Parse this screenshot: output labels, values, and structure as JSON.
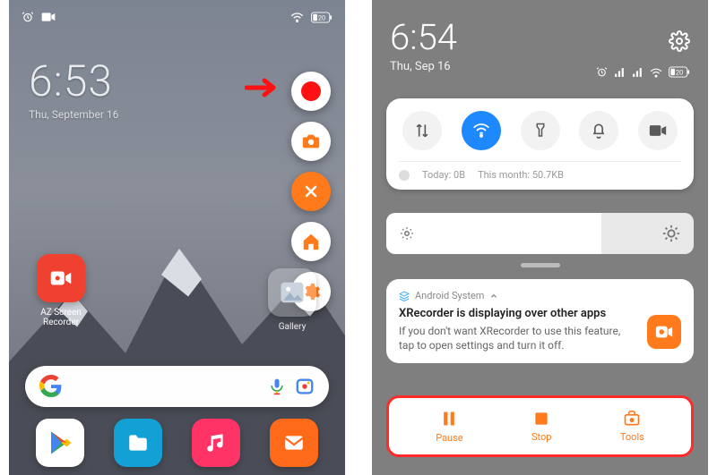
{
  "left": {
    "status": {
      "battery": "20",
      "alarm": true,
      "camera": true
    },
    "clock": {
      "time": "6:53",
      "date": "Thu, September 16"
    },
    "fab": {
      "record": "record",
      "screenshot": "screenshot",
      "close": "close",
      "home": "home",
      "settings": "settings"
    },
    "apps": {
      "az": {
        "name": "AZ Screen Recorder"
      },
      "gallery": {
        "name": "Gallery"
      }
    },
    "dock": {
      "play": "Play Store",
      "files": "Files",
      "music": "Music",
      "mail": "Mail"
    },
    "search": {
      "mic": "voice-search",
      "lens": "lens"
    }
  },
  "right": {
    "clock": {
      "time": "6:54",
      "date": "Thu, Sep 16"
    },
    "status": {
      "battery": "20"
    },
    "qs": {
      "data": "mobile-data",
      "wifi": "wifi",
      "torch": "flashlight",
      "dnd": "do-not-disturb",
      "cam": "screen-record",
      "usage_today_label": "Today:",
      "usage_today_val": "0B",
      "usage_month_label": "This month:",
      "usage_month_val": "50.7KB"
    },
    "notif": {
      "source": "Android System",
      "title": "XRecorder is displaying over other apps",
      "body": "If you don't want XRecorder to use this feature, tap to open settings and turn it off."
    },
    "ctrl": {
      "pause": "Pause",
      "stop": "Stop",
      "tools": "Tools"
    }
  }
}
